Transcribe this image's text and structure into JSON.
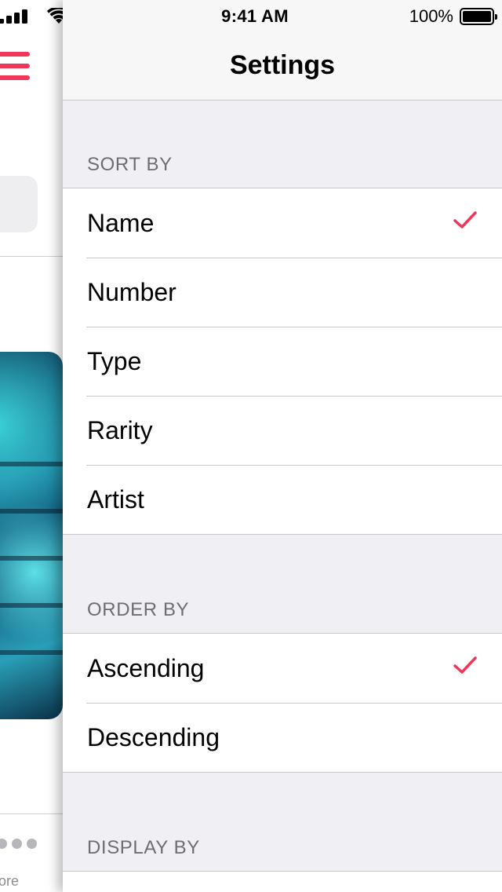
{
  "status_bar": {
    "time": "9:41 AM",
    "battery_percent": "100%",
    "signal_icon": "cellular-signal-icon",
    "wifi_icon": "wifi-icon",
    "battery_icon": "battery-full-icon"
  },
  "background_screen": {
    "menu_icon": "hamburger-menu-icon",
    "partial_text": "ore"
  },
  "nav": {
    "title": "Settings"
  },
  "colors": {
    "accent": "#f0375a",
    "grouped_background": "#efeff4",
    "section_header": "#6d6d72"
  },
  "sections": [
    {
      "header": "SORT BY",
      "options": [
        {
          "label": "Name",
          "selected": true
        },
        {
          "label": "Number",
          "selected": false
        },
        {
          "label": "Type",
          "selected": false
        },
        {
          "label": "Rarity",
          "selected": false
        },
        {
          "label": "Artist",
          "selected": false
        }
      ]
    },
    {
      "header": "ORDER BY",
      "options": [
        {
          "label": "Ascending",
          "selected": true
        },
        {
          "label": "Descending",
          "selected": false
        }
      ]
    },
    {
      "header": "DISPLAY BY",
      "options": []
    }
  ]
}
